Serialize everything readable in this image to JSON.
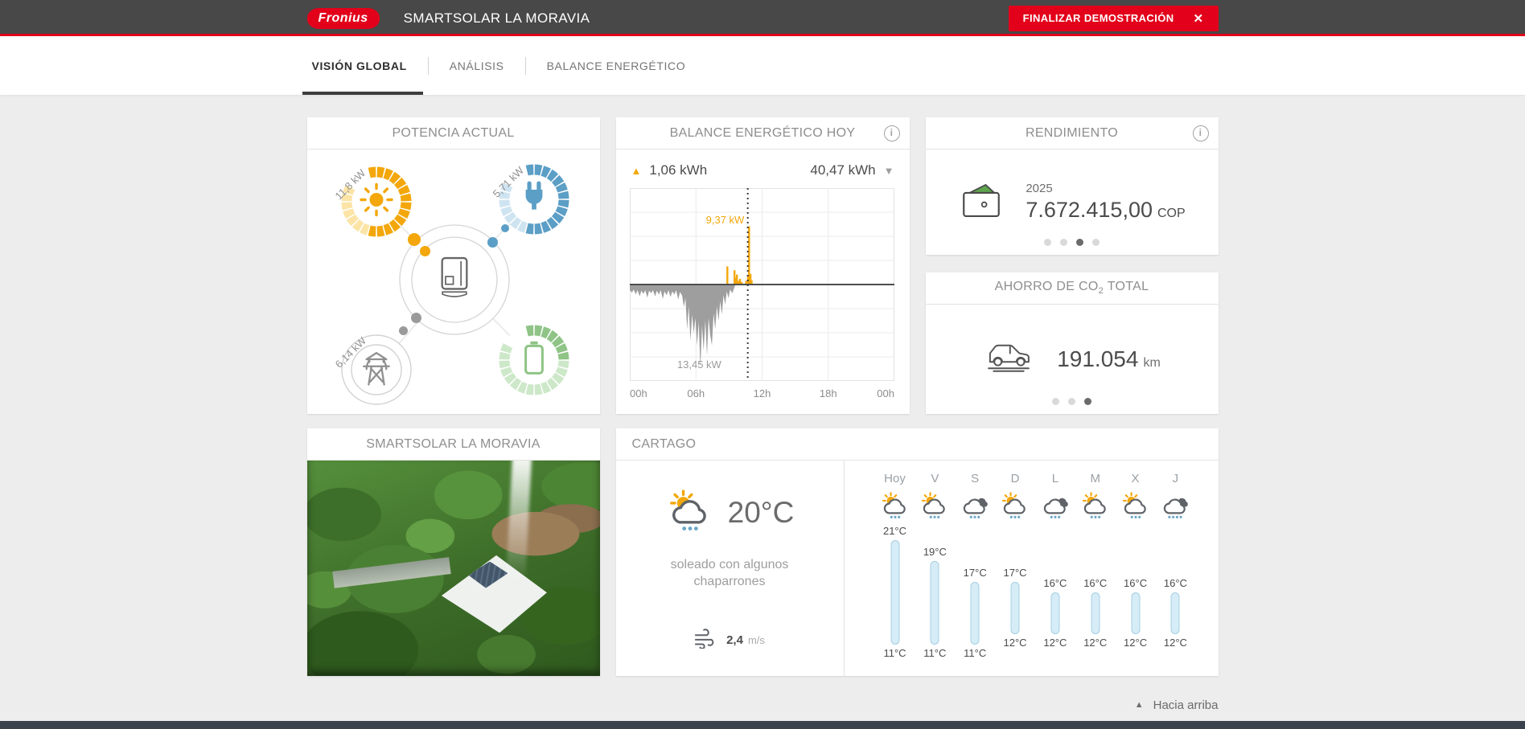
{
  "header": {
    "brand": "Fronius",
    "title": "SMARTSOLAR LA MORAVIA",
    "finish_button_label": "FINALIZAR DEMOSTRACIÓN",
    "close_icon": "✕",
    "bar_color": "#484848",
    "accent_red": "#e2001a"
  },
  "nav": {
    "tabs": [
      {
        "label": "VISIÓN GLOBAL",
        "active": true
      },
      {
        "label": "ANÁLISIS",
        "active": false
      },
      {
        "label": "BALANCE ENERGÉTICO",
        "active": false
      }
    ]
  },
  "power_card": {
    "title": "POTENCIA ACTUAL",
    "pv_label": "11,8 kW",
    "consumption_label": "5,71 kW",
    "grid_label": "6,14 kW",
    "colors": {
      "pv": "#f3a70a",
      "pv_light": "#fbe4a6",
      "consumption": "#5b9ec6",
      "consumption_light": "#cfe4f1",
      "battery": "#8fc486",
      "battery_light": "#cde8c9",
      "grid": "#8f8f8f"
    }
  },
  "balance_card": {
    "title": "BALANCE ENERGÉTICO HOY",
    "produced_today": "1,06 kWh",
    "consumed_today": "40,47 kWh"
  },
  "chart_data": {
    "type": "area",
    "title": "BALANCE ENERGÉTICO HOY",
    "x_range_hours": [
      0,
      24
    ],
    "x_ticks": [
      "00h",
      "06h",
      "12h",
      "18h",
      "00h"
    ],
    "ylim_kw": [
      -15.5,
      15.5
    ],
    "grid": true,
    "zero_axis": true,
    "now_marker_hour": 10.7,
    "production_peak_label": "9,37 kW",
    "consumption_peak_label": "13,45 kW",
    "produced_total_label": "1,06 kWh",
    "consumed_total_label": "40,47 kWh",
    "series": [
      {
        "name": "produccion",
        "color": "#f3a70a",
        "style": "bars",
        "points": [
          [
            8.85,
            2.9
          ],
          [
            9.5,
            2.3
          ],
          [
            9.62,
            1.1
          ],
          [
            9.72,
            1.6
          ],
          [
            9.85,
            0.6
          ],
          [
            10.0,
            0.9
          ],
          [
            10.15,
            0.4
          ],
          [
            10.55,
            0.6
          ],
          [
            10.72,
            1.4
          ],
          [
            10.82,
            9.37
          ],
          [
            10.95,
            1.7
          ],
          [
            11.05,
            0.7
          ]
        ]
      },
      {
        "name": "consumo",
        "color": "#9e9e9e",
        "style": "area",
        "points": [
          [
            0,
            -0.9
          ],
          [
            0.2,
            -1.3
          ],
          [
            0.35,
            -0.8
          ],
          [
            0.55,
            -1.6
          ],
          [
            0.7,
            -0.9
          ],
          [
            0.9,
            -1.9
          ],
          [
            1.05,
            -1.0
          ],
          [
            1.25,
            -1.5
          ],
          [
            1.4,
            -0.9
          ],
          [
            1.6,
            -2.1
          ],
          [
            1.75,
            -1.0
          ],
          [
            1.95,
            -1.4
          ],
          [
            2.1,
            -0.9
          ],
          [
            2.3,
            -1.9
          ],
          [
            2.45,
            -1.0
          ],
          [
            2.65,
            -1.6
          ],
          [
            2.8,
            -0.9
          ],
          [
            3.0,
            -2.3
          ],
          [
            3.15,
            -1.1
          ],
          [
            3.35,
            -1.7
          ],
          [
            3.5,
            -0.9
          ],
          [
            3.7,
            -2.0
          ],
          [
            3.85,
            -1.1
          ],
          [
            4.05,
            -1.6
          ],
          [
            4.2,
            -0.9
          ],
          [
            4.4,
            -2.4
          ],
          [
            4.55,
            -1.2
          ],
          [
            4.75,
            -1.8
          ],
          [
            4.9,
            -3.6
          ],
          [
            5.05,
            -2.2
          ],
          [
            5.2,
            -7.2
          ],
          [
            5.35,
            -3.5
          ],
          [
            5.5,
            -9.0
          ],
          [
            5.65,
            -4.8
          ],
          [
            5.8,
            -7.8
          ],
          [
            5.95,
            -5.4
          ],
          [
            6.1,
            -9.8
          ],
          [
            6.25,
            -6.0
          ],
          [
            6.4,
            -13.45
          ],
          [
            6.55,
            -6.6
          ],
          [
            6.7,
            -10.6
          ],
          [
            6.85,
            -5.8
          ],
          [
            7.0,
            -11.4
          ],
          [
            7.15,
            -5.4
          ],
          [
            7.3,
            -8.2
          ],
          [
            7.45,
            -9.8
          ],
          [
            7.6,
            -4.6
          ],
          [
            7.75,
            -7.2
          ],
          [
            7.9,
            -3.5
          ],
          [
            8.05,
            -5.8
          ],
          [
            8.2,
            -2.7
          ],
          [
            8.35,
            -4.8
          ],
          [
            8.5,
            -1.7
          ],
          [
            8.65,
            -3.2
          ],
          [
            8.8,
            -1.1
          ],
          [
            8.95,
            -2.2
          ],
          [
            9.1,
            -0.8
          ],
          [
            9.3,
            -1.4
          ],
          [
            9.5,
            -0.4
          ],
          [
            9.6,
            0
          ]
        ]
      }
    ]
  },
  "yield_card": {
    "title": "RENDIMIENTO",
    "year": "2025",
    "amount": "7.672.415,00",
    "currency": "COP",
    "dots": 4,
    "active_dot": 2
  },
  "co2_card": {
    "title_main": "AHORRO DE CO",
    "title_sub": "2",
    "title_tail": "TOTAL",
    "value": "191.054",
    "unit": "km",
    "dots": 3,
    "active_dot": 2
  },
  "site_card": {
    "title": "SMARTSOLAR LA MORAVIA"
  },
  "weather_card": {
    "title": "CARTAGO",
    "current_temp": "20°C",
    "condition": "soleado con algunos chaparrones",
    "current_icon": "sun_shower",
    "wind_speed": "2,4",
    "wind_unit": "m/s",
    "temp_scale": {
      "max_c": 21,
      "min_c": 11
    },
    "forecast": [
      {
        "day": "Hoy",
        "icon": "sun_shower",
        "high": "21°C",
        "low": "11°C",
        "high_c": 21,
        "low_c": 11
      },
      {
        "day": "V",
        "icon": "sun_shower",
        "high": "19°C",
        "low": "11°C",
        "high_c": 19,
        "low_c": 11
      },
      {
        "day": "S",
        "icon": "rain",
        "high": "17°C",
        "low": "11°C",
        "high_c": 17,
        "low_c": 11
      },
      {
        "day": "D",
        "icon": "sun_shower",
        "high": "17°C",
        "low": "12°C",
        "high_c": 17,
        "low_c": 12
      },
      {
        "day": "L",
        "icon": "rain",
        "high": "16°C",
        "low": "12°C",
        "high_c": 16,
        "low_c": 12
      },
      {
        "day": "M",
        "icon": "sun_shower",
        "high": "16°C",
        "low": "12°C",
        "high_c": 16,
        "low_c": 12
      },
      {
        "day": "X",
        "icon": "sun_shower",
        "high": "16°C",
        "low": "12°C",
        "high_c": 16,
        "low_c": 12
      },
      {
        "day": "J",
        "icon": "heavy_rain",
        "high": "16°C",
        "low": "12°C",
        "high_c": 16,
        "low_c": 12
      }
    ]
  },
  "footer": {
    "back_to_top": "Hacia arriba",
    "up_icon": "▲"
  }
}
